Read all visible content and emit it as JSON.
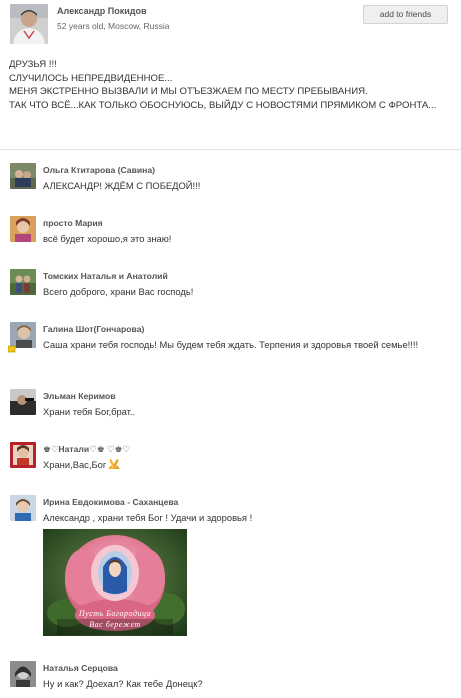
{
  "author": {
    "name": "Александр Покидов",
    "meta": "52 years old, Moscow, Russia",
    "add_friend_label": "add to friends"
  },
  "post": {
    "text": "ДРУЗЬЯ !!!\nСЛУЧИЛОСЬ НЕПРЕДВИДЕННОЕ...\nМЕНЯ ЭКСТРЕННО ВЫЗВАЛИ И МЫ ОТЪЕЗЖАЕМ ПО МЕСТУ ПРЕБЫВАНИЯ.\nТАК ЧТО ВСЁ...КАК ТОЛЬКО ОБОСНУЮСЬ, ВЫЙДУ С НОВОСТЯМИ ПРЯМИКОМ С ФРОНТА..."
  },
  "comments": [
    {
      "name": "Ольга Ктитарова (Савина)",
      "text": "АЛЕКСАНДР!  ЖДЁМ С ПОБЕДОЙ!!!"
    },
    {
      "name": "просто Мария",
      "text": "всё будет хорошо,я это знаю!"
    },
    {
      "name": "Томских Наталья и Анатолий",
      "text": "Всего доброго, храни Вас господь!"
    },
    {
      "name": "Галина Шот(Гончарова)",
      "text": "Саша храни тебя господь! Мы будем тебя ждать. Терпения  и здоровья твоей семье!!!!"
    },
    {
      "name": "Эльман Керимов",
      "text": "Храни тебя Бог,брат.."
    },
    {
      "name": "♚♡Натали♡♚ ♡♚♡",
      "text": "Храни,Вас,Бог"
    },
    {
      "name": "Ирина Евдокимова - Саханцева",
      "text": "Александр , храни тебя Бог ! Удачи и здоровья !",
      "photo_caption_1": "Пусть Богородица",
      "photo_caption_2": "Вас бережет"
    },
    {
      "name": "Наталья Серцова",
      "text": "Ну и как? Доехал? Как тебе Донецк?"
    }
  ],
  "icons": {
    "pray": "folded-hands-icon",
    "online": "online-status-icon"
  },
  "colors": {
    "name_text": "#555555",
    "body_text": "#333333",
    "button_bg": "#efefef",
    "rose": "#e07a93"
  }
}
